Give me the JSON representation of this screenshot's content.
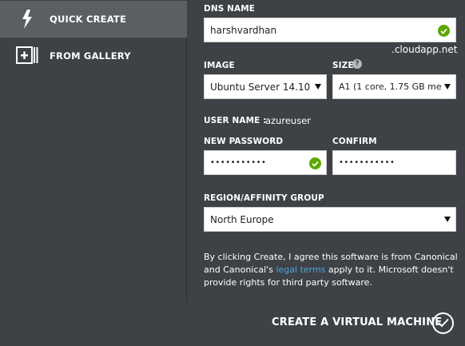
{
  "sidebar": {
    "items": [
      {
        "label": "QUICK CREATE",
        "icon": "lightning-icon",
        "active": true
      },
      {
        "label": "FROM GALLERY",
        "icon": "gallery-add-icon",
        "active": false
      }
    ]
  },
  "form": {
    "dns_name": {
      "label": "DNS NAME",
      "value": "harshvardhan",
      "suffix": ".cloudapp.net"
    },
    "image": {
      "label": "IMAGE",
      "value": "Ubuntu Server 14.10"
    },
    "size": {
      "label": "SIZE",
      "value": "A1 (1 core, 1.75 GB me",
      "help_icon": "help-icon"
    },
    "user_name": {
      "label": "USER NAME :",
      "value": "azureuser"
    },
    "new_password": {
      "label": "NEW PASSWORD",
      "value": "•••••••••••"
    },
    "confirm": {
      "label": "CONFIRM",
      "value": "•••••••••••"
    },
    "region": {
      "label": "REGION/AFFINITY GROUP",
      "value": "North Europe"
    }
  },
  "note": {
    "text_before": "By clicking Create, I agree this software is from Canonical and Canonical's ",
    "link": "legal terms",
    "text_after": " apply to it. Microsoft doesn't provide rights for third party software."
  },
  "footer": {
    "create_label": "CREATE A VIRTUAL MACHINE"
  },
  "colors": {
    "background": "#3e4146",
    "active_nav": "#5b5e63",
    "valid_check": "#5aa800",
    "link": "#4aa8e0"
  }
}
